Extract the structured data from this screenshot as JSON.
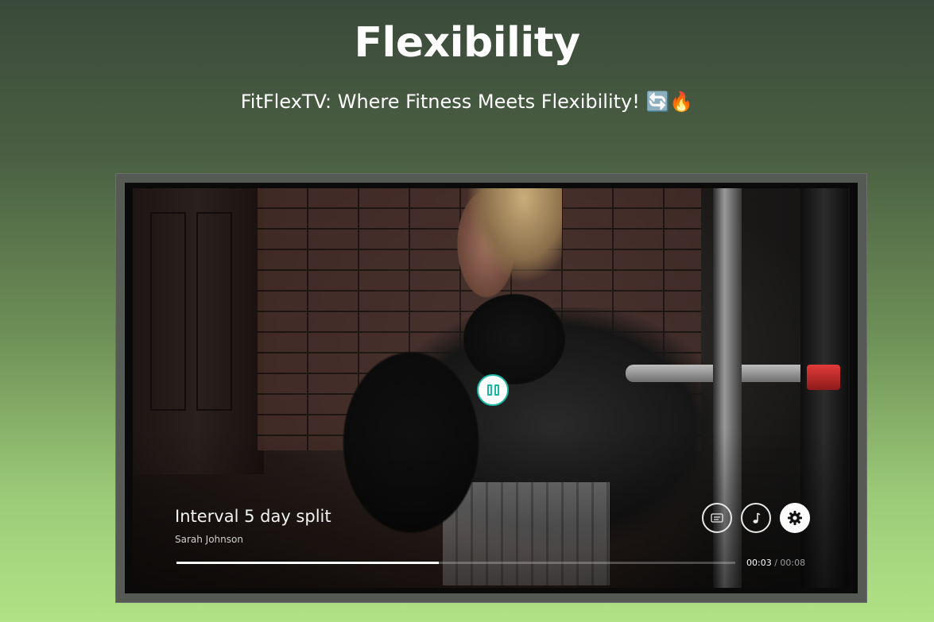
{
  "page": {
    "title": "Flexibility",
    "subtitle": "FitFlexTV: Where Fitness Meets Flexibility! 🔄🔥"
  },
  "player": {
    "video_title": "Interval 5 day split",
    "author": "Sarah Johnson",
    "current_time": "00:03",
    "separator": "/",
    "duration": "00:08",
    "progress": 0.47,
    "state": "playing",
    "accent_color": "#19b7a4",
    "controls": {
      "play_pause_icon": "pause-icon",
      "captions_icon": "captions-icon",
      "music_icon": "music-note-icon",
      "settings_icon": "gear-icon"
    }
  }
}
